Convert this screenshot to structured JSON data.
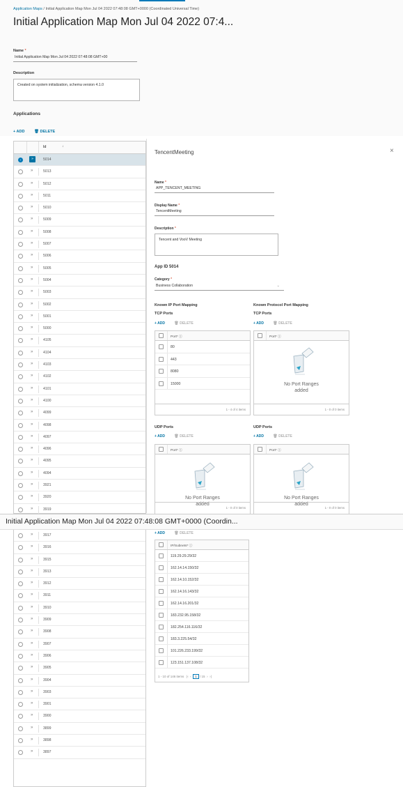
{
  "breadcrumb": {
    "link": "Application Maps",
    "separator": "/",
    "current": "Initial Application Map Mon Jul 04 2022 07:48:08 GMT+0000 (Coordinated Universal Time)"
  },
  "page_title": "Initial Application Map Mon Jul 04 2022 07:4...",
  "form": {
    "name_label": "Name",
    "name_value": "Initial Application Map Mon Jul 04 2022 07:48:08 GMT+00",
    "description_label": "Description",
    "description_value": "Created on system initialization, schema version 4.1.0"
  },
  "applications": {
    "heading": "Applications",
    "add_label": "+ ADD",
    "delete_label": "🗑 DELETE",
    "id_header": "Id",
    "sort_arrow": "↓",
    "rows_top": [
      "5014",
      "5013",
      "5012",
      "5011",
      "5010",
      "5009",
      "5008",
      "5007",
      "5006",
      "5005",
      "5004",
      "5003",
      "5002",
      "5001",
      "5000",
      "4105",
      "4104",
      "4103",
      "4102",
      "4101",
      "4100",
      "4099",
      "4098",
      "4097",
      "4096",
      "4095",
      "4094",
      "3921",
      "3920",
      "3919"
    ],
    "rows_bottom": [
      "3917",
      "3916",
      "3915",
      "3913",
      "3912",
      "3911",
      "3910",
      "3909",
      "3908",
      "3907",
      "3906",
      "3905",
      "3904",
      "3903",
      "3901",
      "3900",
      "3899",
      "3898",
      "3897"
    ]
  },
  "detail": {
    "title": "TencentMeeting",
    "close_icon": "×",
    "name_label": "Name",
    "name_value": "APP_TENCENT_MEETING",
    "display_name_label": "Display Name",
    "display_name_value": "TencentMeeting",
    "description_label": "Description",
    "description_value": "Tencent and VooV Meeting",
    "app_id": "App ID 5014",
    "category_label": "Category",
    "category_value": "Business Collaboration",
    "known_ip_heading": "Known IP Port Mapping",
    "known_protocol_heading": "Known Protocol Port Mapping",
    "tcp_ports": "TCP Ports",
    "udp_ports": "UDP Ports",
    "add_label": "+ ADD",
    "delete_label": "🗑 DELETE",
    "port_header": "Port* ⓘ",
    "ip_tcp_ports": [
      "80",
      "443",
      "8080",
      "15000"
    ],
    "ip_tcp_footer": "1 - 4 of 4 items",
    "empty_text_1": "No Port Ranges",
    "empty_text_2": "added",
    "empty_footer": "1 - 0 of 0 items",
    "subnets_header": "IP/Subnets* ⓘ",
    "subnets": [
      "119.29.29.29/32",
      "162.14.14.150/32",
      "162.14.10.152/32",
      "162.14.16.143/32",
      "162.14.16.201/32",
      "183.232.95.158/32",
      "182.254.116.116/32",
      "183.3.225.54/32",
      "101.226.233.199/32",
      "123.151.137.108/32"
    ],
    "subnets_pager_text": "1 - 10 of 146 items",
    "subnets_page": "1",
    "subnets_pages": "/ 15"
  },
  "sticky_title": "Initial Application Map Mon Jul 04 2022 07:48:08 GMT+0000 (Coordin..."
}
